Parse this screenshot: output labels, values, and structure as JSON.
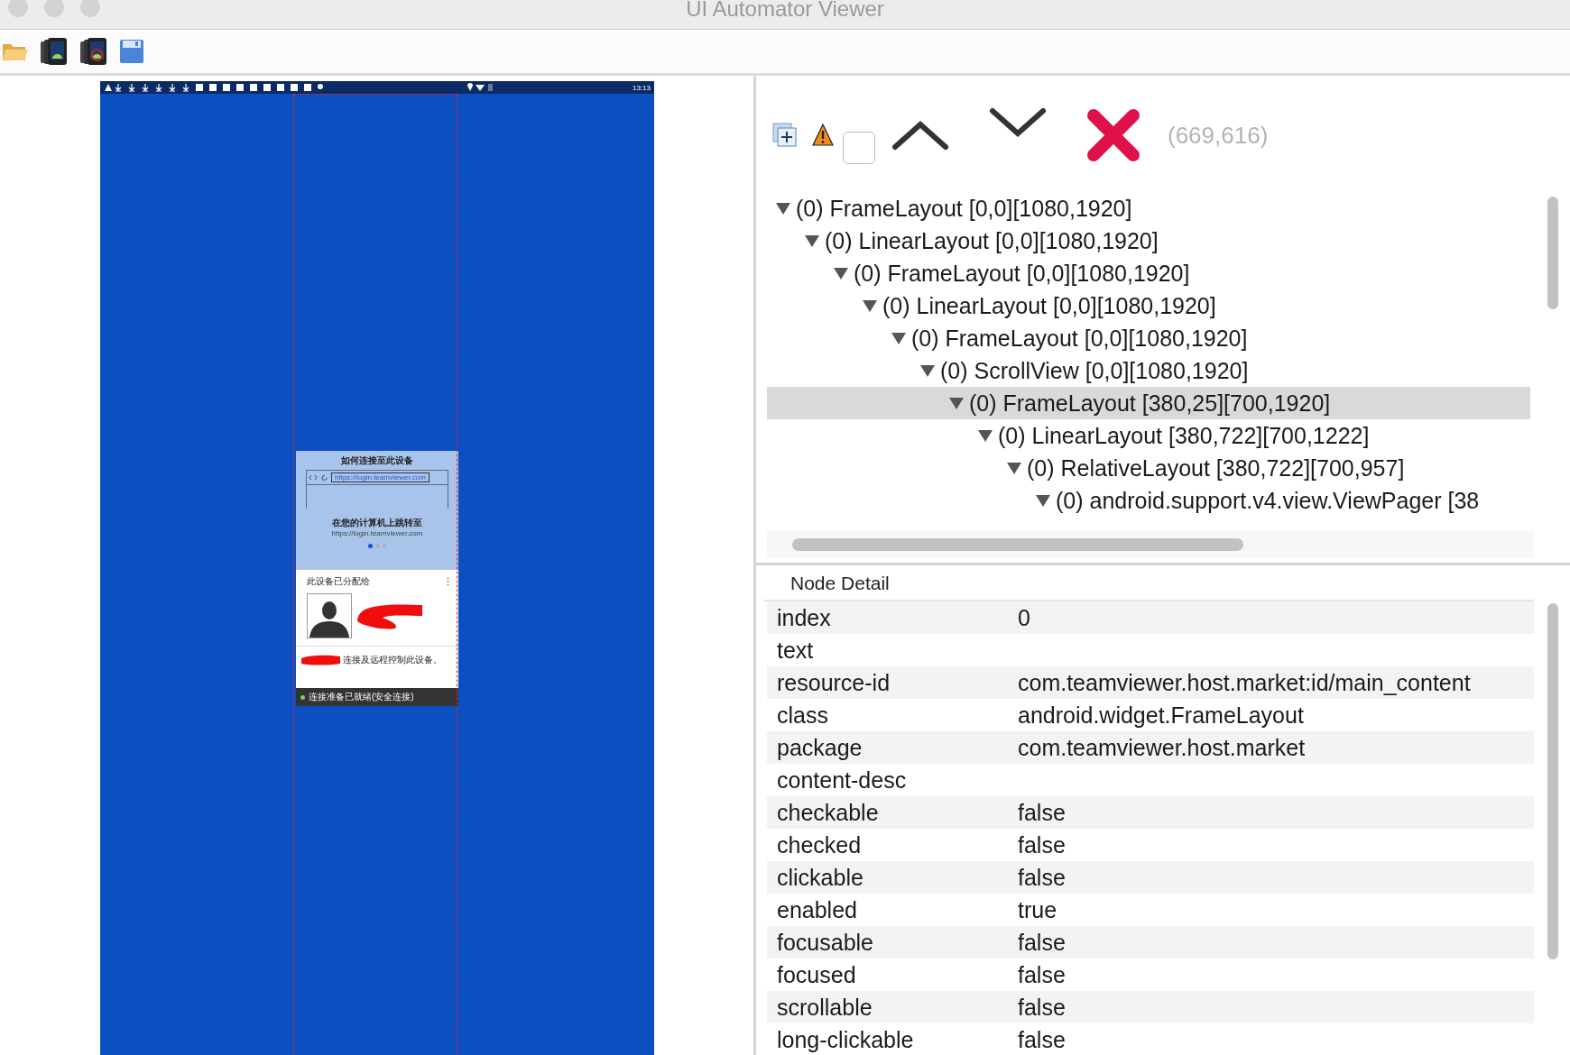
{
  "window": {
    "title": "UI Automator Viewer"
  },
  "device_screen": {
    "status_time": "13:13",
    "heading": "如何连接至此设备",
    "browser_url": "https://login.teamviewer.com",
    "instruction": "在您的计算机上跳转至",
    "url": "https://login.teamviewer.com",
    "page_dots": [
      {
        "selected": true
      },
      {
        "selected": false
      },
      {
        "selected": false
      }
    ],
    "assigned_title": "此设备已分配给",
    "assigned_note": "连接及远程控制此设备。",
    "status": "连接准备已就绪(安全连接)"
  },
  "tree_toolbar": {
    "checkbox": {
      "checked": false
    },
    "coordinates": "(669,616)"
  },
  "tree": [
    {
      "label": "(0) FrameLayout [0,0][1080,1920]",
      "expanded": true,
      "selected": false,
      "children": [
        {
          "label": "(0) LinearLayout [0,0][1080,1920]",
          "expanded": true,
          "selected": false,
          "children": [
            {
              "label": "(0) FrameLayout [0,0][1080,1920]",
              "expanded": true,
              "selected": false,
              "children": [
                {
                  "label": "(0) LinearLayout [0,0][1080,1920]",
                  "expanded": true,
                  "selected": false,
                  "children": [
                    {
                      "label": "(0) FrameLayout [0,0][1080,1920]",
                      "expanded": true,
                      "selected": false,
                      "children": [
                        {
                          "label": "(0) ScrollView [0,0][1080,1920]",
                          "expanded": true,
                          "selected": false,
                          "children": [
                            {
                              "label": "(0) FrameLayout [380,25][700,1920]",
                              "expanded": true,
                              "selected": true,
                              "children": [
                                {
                                  "label": "(0) LinearLayout [380,722][700,1222]",
                                  "expanded": true,
                                  "selected": false,
                                  "children": [
                                    {
                                      "label": "(0) RelativeLayout [380,722][700,957]",
                                      "expanded": true,
                                      "selected": false,
                                      "children": [
                                        {
                                          "label": "(0) android.support.v4.view.ViewPager [38",
                                          "expanded": true,
                                          "selected": false
                                        }
                                      ]
                                    }
                                  ]
                                }
                              ]
                            }
                          ]
                        }
                      ]
                    }
                  ]
                }
              ]
            }
          ]
        }
      ]
    }
  ],
  "node_detail": {
    "title": "Node Detail",
    "rows": [
      {
        "key": "index",
        "value": "0"
      },
      {
        "key": "text"
      },
      {
        "key": "resource-id",
        "value": "com.teamviewer.host.market:id/main_content"
      },
      {
        "key": "class",
        "value": "android.widget.FrameLayout"
      },
      {
        "key": "package",
        "value": "com.teamviewer.host.market"
      },
      {
        "key": "content-desc"
      },
      {
        "key": "checkable",
        "value": "false"
      },
      {
        "key": "checked",
        "value": "false"
      },
      {
        "key": "clickable",
        "value": "false"
      },
      {
        "key": "enabled",
        "value": "true"
      },
      {
        "key": "focusable",
        "value": "false"
      },
      {
        "key": "focused",
        "value": "false"
      },
      {
        "key": "scrollable",
        "value": "false"
      },
      {
        "key": "long-clickable",
        "value": "false"
      }
    ]
  }
}
